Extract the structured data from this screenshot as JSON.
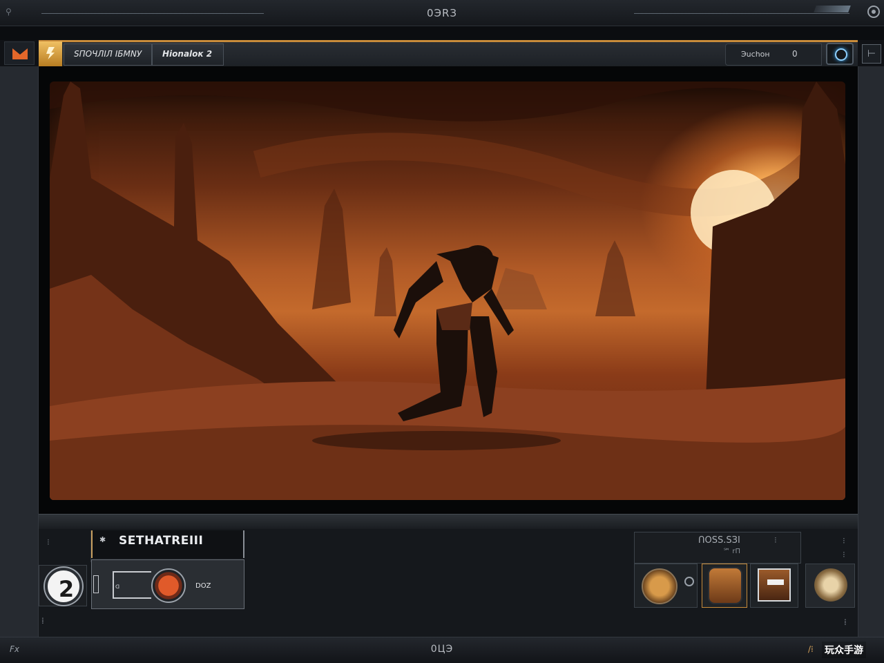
{
  "window": {
    "title": "0ЭRЗ",
    "corner_mark": "⚲"
  },
  "toolbar": {
    "tab1_label": "SПOЧЛІЛ IБMNУ",
    "tab2_label": "Нionalок 2",
    "right_label": "Эuchон",
    "right_value": "0",
    "side_glyph": "⊢"
  },
  "hud": {
    "left_top_mark": "⁝",
    "skill_title": "SETHATRЕIII",
    "skill_mark": "✱",
    "level": "2",
    "ability_label": "DOZ",
    "ability_small_label": "ᗡ",
    "left_bottom_mark": "⁞",
    "status_text": "ՈOSS.SЗI",
    "status_sub": "℠ rП",
    "status_mark": "⁝",
    "right_top_mark": "⁝",
    "right_top_mark2": "⁝",
    "right_bottom_mark": "⁞"
  },
  "statusbar": {
    "left": "Fx",
    "center": "0ЦЭ",
    "right_mark": "/⁞",
    "watermark": "玩众手游"
  },
  "colors": {
    "accent_orange": "#c98c3a",
    "app_icon": "#e3672a",
    "scene_sky": "#b15a26"
  }
}
